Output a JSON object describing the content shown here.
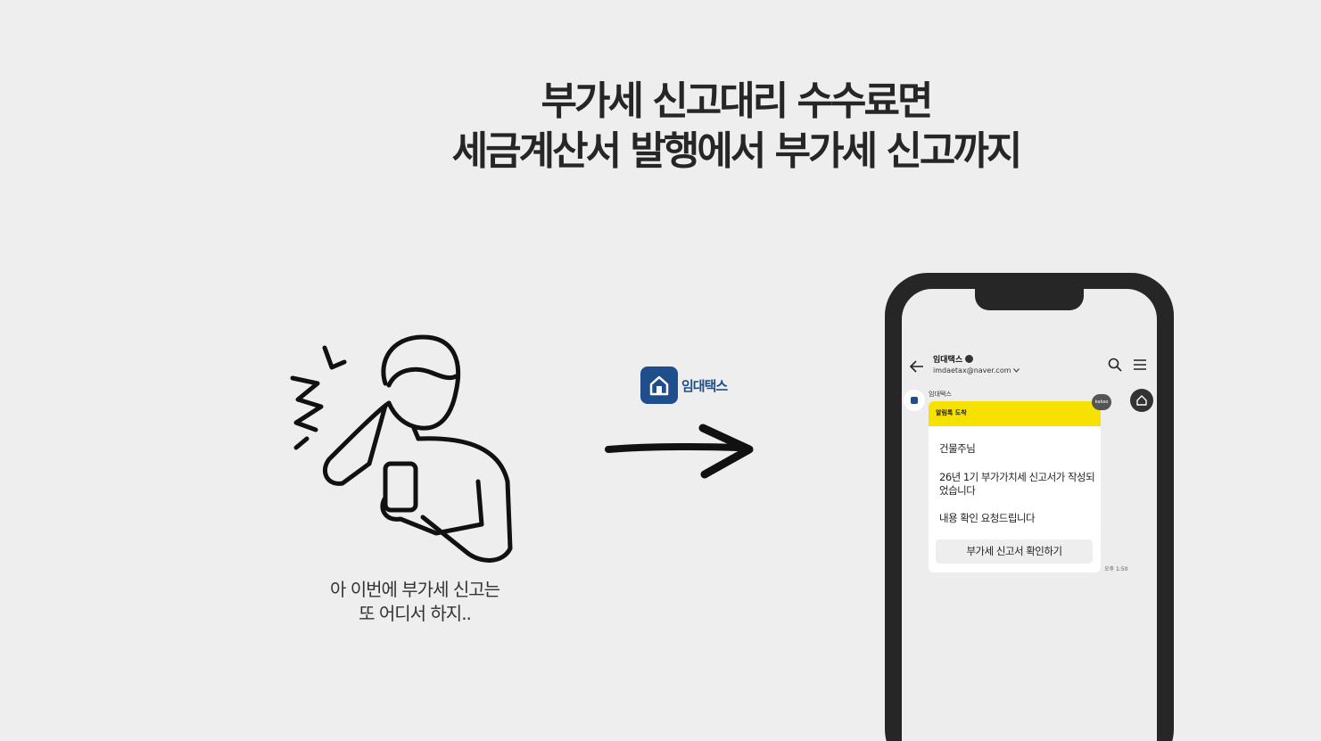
{
  "headline": {
    "line1": "부가세 신고대리 수수료면",
    "line2": "세금계산서 발행에서 부가세 신고까지"
  },
  "person": {
    "caption_line1": "아 이번에 부가세 신고는",
    "caption_line2": "또 어디서 하지.."
  },
  "brand": {
    "name": "임대택스",
    "color": "#1f4e8c"
  },
  "phone": {
    "channel_name": "임대택스",
    "channel_email": "imdaetax@naver.com",
    "sender": "임대택스",
    "badge": "kakao",
    "notice_title": "알림톡 도착",
    "greeting": "건물주님",
    "body": "26년 1기 부가가치세 신고서가 작성되었습니다",
    "request": "내용 확인 요청드립니다",
    "button_label": "부가세 신고서 확인하기",
    "time": "오후 1:50",
    "accent": "#f7e100"
  },
  "icons": [
    "back-arrow-icon",
    "verified-icon",
    "chevron-down-icon",
    "search-icon",
    "menu-icon",
    "home-icon",
    "right-arrow-icon"
  ]
}
